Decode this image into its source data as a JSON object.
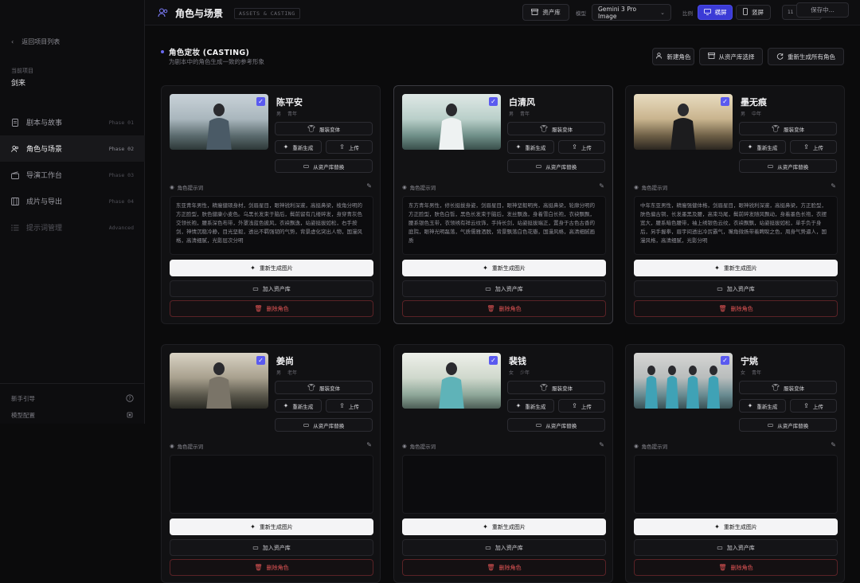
{
  "sidebar": {
    "back_label": "返回项目列表",
    "project_label": "当前项目",
    "project_name": "剑来",
    "items": [
      {
        "label": "剧本与故事",
        "phase": "Phase 01"
      },
      {
        "label": "角色与场景",
        "phase": "Phase 02"
      },
      {
        "label": "导演工作台",
        "phase": "Phase 03"
      },
      {
        "label": "成片与导出",
        "phase": "Phase 04"
      },
      {
        "label": "提示词管理",
        "phase": "Advanced"
      }
    ],
    "footer": [
      {
        "label": "新手引导",
        "icon": "help-icon"
      },
      {
        "label": "模型配置",
        "icon": "chip-icon"
      }
    ]
  },
  "topbar": {
    "title": "角色与场景",
    "tag": "ASSETS & CASTING",
    "asset_lib": "资产库",
    "model_label": "模型",
    "model_value": "Gemini 3 Pro Image",
    "ratio_label": "比例",
    "landscape": "横屏",
    "portrait": "竖屏",
    "chars": "11 CHA",
    "saving": "保存中..."
  },
  "section": {
    "title": "角色定妆 (CASTING)",
    "subtitle": "为剧本中的角色生成一致的参考形象",
    "new_role": "新建角色",
    "from_lib": "从资产库选择",
    "regen_all": "重新生成所有角色"
  },
  "card_labels": {
    "variant": "服装变体",
    "regen": "重新生成",
    "upload": "上传",
    "replace_lib": "从资产库替换",
    "prompt_label": "角色提示词",
    "regen_image": "重新生成图片",
    "add_lib": "加入资产库",
    "delete": "删除角色"
  },
  "characters": [
    {
      "name": "陈平安",
      "gender": "男",
      "age": "青年",
      "prompt": "东亚青年男性，精瘦健硕身材，剑眉星目，眼神锐利深邃，高挺鼻梁，棱角分明的方正脸型，肤色健康小麦色。乌黑长发束于脑后，鬓前留有几缕碎发，身穿青灰色交领长袍，腰系深色布带，外罩浅蓝色披风，衣袂飘逸，站姿挺拔如松，右手按剑，神情沉稳冷静，目光坚毅，透出不羁强韧的气势，背景虚化突出人物，国漫风格，高清细腻，光影层次分明"
    },
    {
      "name": "白清风",
      "gender": "男",
      "age": "青年",
      "prompt": "东方青年男性，修长挺拔身姿，剑眉星目，眼神坚毅明亮，高挺鼻梁，轮廓分明的方正脸型，肤色白皙，黑色长发束于脑后，发丝飘逸，身着雪白长袍，衣袂飘飘，腰系银色玉带，衣领绣有祥云纹饰，手持长剑，站姿挺拔端正，置身于古色古香的庭院，眼神光明磊落，气质儒雅洒脱，背景飘落白色花瓣，国漫风格，高清细腻画质"
    },
    {
      "name": "墨无痕",
      "gender": "男",
      "age": "中年",
      "prompt": "中年东亚男性，精瘦强健体格，剑眉星目，眼神锐利深邃，高挺鼻梁，方正脸型，肤色偏古铜，长发墨黑及腰，高束马尾，鬓前碎发随风飘动，身着墨色长袍，衣摆宽大，腰系暗色腰带，袖上绣银色云纹，衣袂飘飘，站姿挺拔如松，单手负于身后，另手握拳，眉宇间透出冷厉霸气，嘴角微扬带着睥睨之色，周身气势逼人，国漫风格，高清细腻，光影分明"
    },
    {
      "name": "姜尚",
      "gender": "男",
      "age": "老年",
      "prompt": ""
    },
    {
      "name": "裴钱",
      "gender": "女",
      "age": "少年",
      "prompt": ""
    },
    {
      "name": "宁姚",
      "gender": "女",
      "age": "青年",
      "prompt": ""
    }
  ],
  "colors": {
    "accent": "#3b3bd6",
    "danger": "#e25555",
    "bg": "#0b0b0c"
  }
}
